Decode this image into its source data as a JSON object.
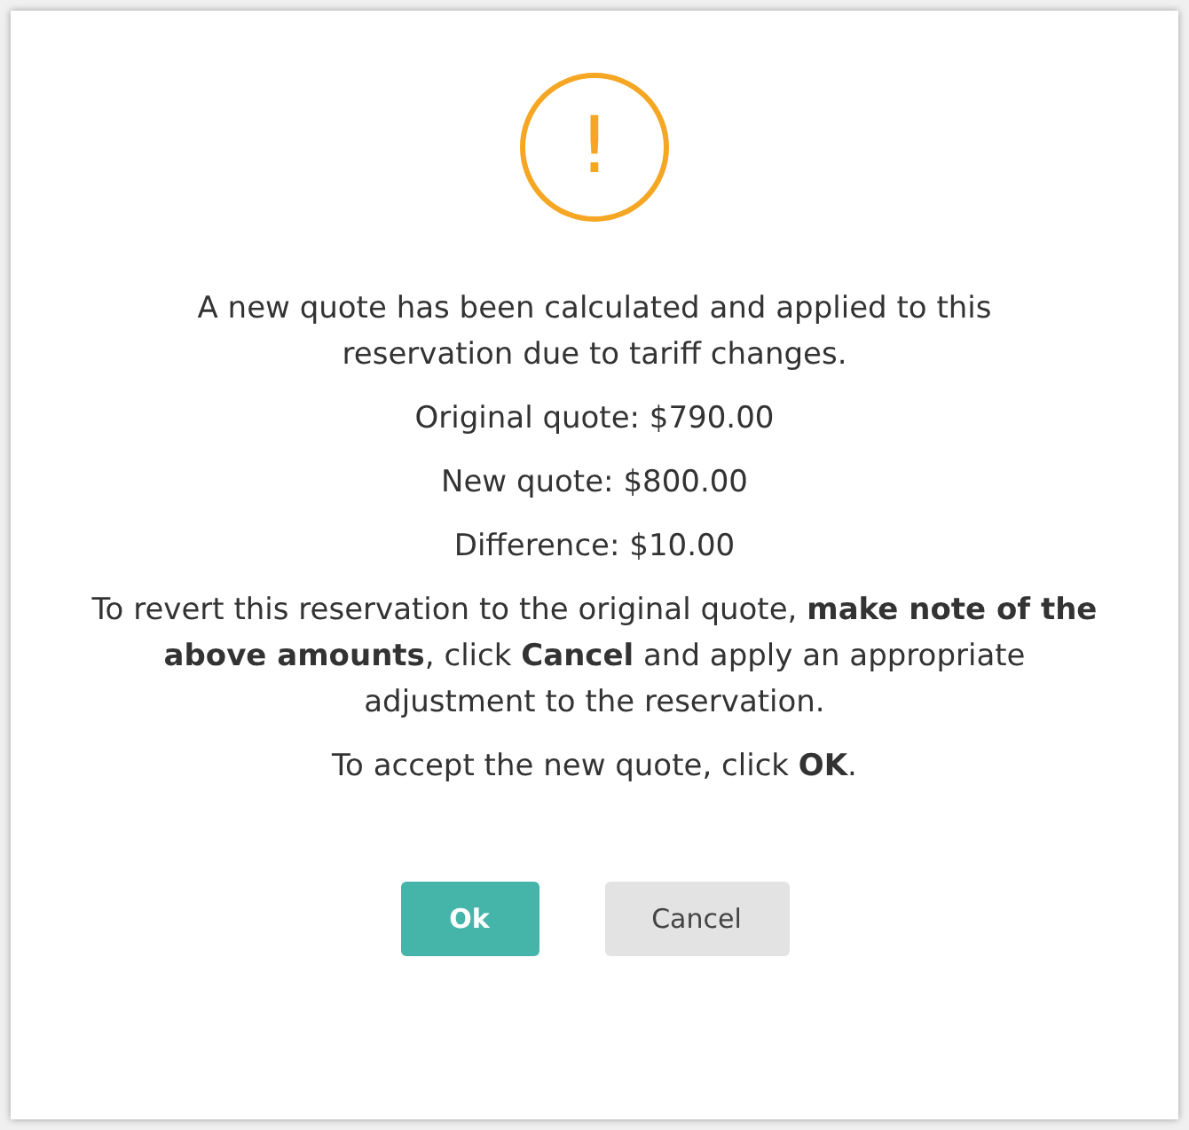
{
  "dialog": {
    "icon": "!",
    "paragraphs": [
      "A new quote has been calculated and applied to this reservation due to tariff changes.",
      "Original quote: $790.00",
      "New quote: $800.00",
      "Difference: $10.00",
      "To revert this reservation to the original quote, **make note of the above amounts**, click **Cancel** and apply an appropriate adjustment to the reservation.",
      "To accept the new quote, click **OK**."
    ],
    "buttons": [
      {
        "label": "Ok",
        "kind": "primary"
      },
      {
        "label": "Cancel",
        "kind": "secondary"
      }
    ]
  }
}
